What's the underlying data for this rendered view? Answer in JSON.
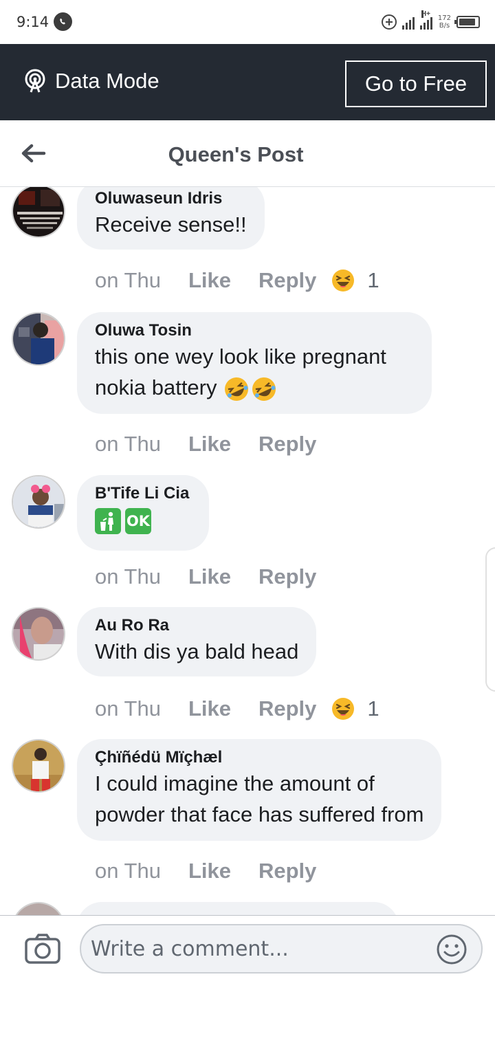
{
  "status_bar": {
    "time": "9:14",
    "network_type": "H+",
    "net_speed_value": "172",
    "net_speed_unit": "B/s",
    "battery_level": 0.9
  },
  "data_bar": {
    "mode_label": "Data Mode",
    "go_free_label": "Go to Free"
  },
  "header": {
    "title": "Queen's Post"
  },
  "comments": [
    {
      "author": "Oluwaseun Idris",
      "text": "Receive sense!!",
      "time": "on Thu",
      "like_label": "Like",
      "reply_label": "Reply",
      "reaction": "haha",
      "reaction_count": "1"
    },
    {
      "author": "Oluwa Tosin",
      "text": "this one wey look like pregnant\nnokia battery",
      "time": "on Thu",
      "like_label": "Like",
      "reply_label": "Reply"
    },
    {
      "author": "B'Tife Li Cia",
      "text": "",
      "emoji_badges": [
        "litter-bin-icon",
        "ok-button-icon"
      ],
      "ok_badge_text": "OK",
      "time": "on Thu",
      "like_label": "Like",
      "reply_label": "Reply"
    },
    {
      "author": "Au Ro Ra",
      "text": "With dis ya bald head",
      "time": "on Thu",
      "like_label": "Like",
      "reply_label": "Reply",
      "reaction": "haha",
      "reaction_count": "1"
    },
    {
      "author": "Çhïñédü Mïçhæl",
      "text": "I could imagine the amount of\npowder that face has suffered from",
      "time": "on Thu",
      "like_label": "Like",
      "reply_label": "Reply"
    }
  ],
  "composer": {
    "placeholder": "Write a comment..."
  },
  "colors": {
    "data_bar_bg": "#242a33",
    "bubble_bg": "#f0f2f5",
    "muted_text": "#90949c",
    "reaction_yellow": "#f7b928"
  }
}
